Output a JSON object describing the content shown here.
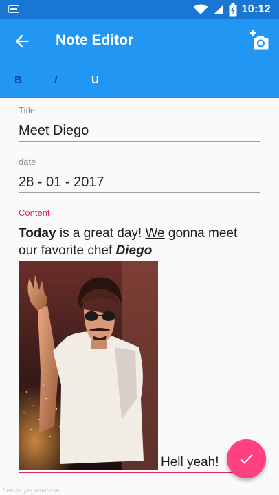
{
  "status_bar": {
    "time": "10:12"
  },
  "app_bar": {
    "title": "Note Editor"
  },
  "format_bar": {
    "bold": "B",
    "italic": "I",
    "underline": "U"
  },
  "form": {
    "title": {
      "label": "Title",
      "value": "Meet Diego"
    },
    "date": {
      "label": "date",
      "value": "28 - 01 - 2017"
    },
    "content": {
      "label": "Content",
      "word_today": "Today",
      "text_1": " is a great day! ",
      "word_we": "We",
      "text_2": " gonna meet our favorite chef ",
      "word_diego": "Diego",
      "caption": "Hell yeah!"
    }
  },
  "watermark": "free for personal use",
  "colors": {
    "primary": "#2196f3",
    "primary_dark": "#1976d2",
    "accent": "#ff4081",
    "content_label": "#e91e63"
  },
  "icons": [
    "keyboard-icon",
    "wifi-icon",
    "signal-icon",
    "battery-charging-icon",
    "back-arrow-icon",
    "add-photo-icon",
    "check-icon"
  ]
}
